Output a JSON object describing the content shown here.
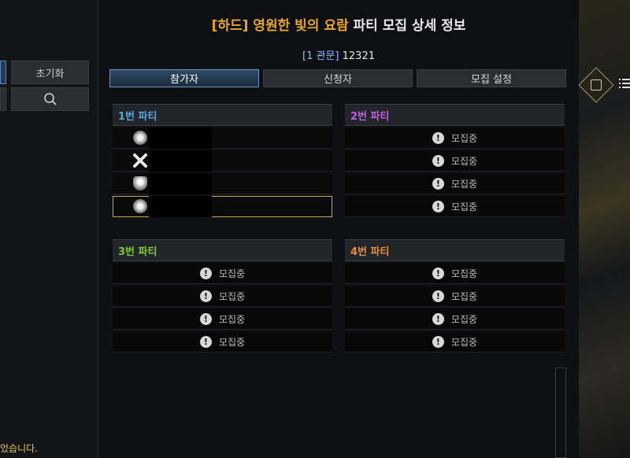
{
  "left": {
    "reset_label": "초기화",
    "notice_tail": "었습니다."
  },
  "window": {
    "title_accent": "[하드] 영원한 빛의 요람",
    "title_rest": "파티 모집 상세 정보",
    "subtitle_bracket": "[1 관문]",
    "subtitle_value": "12321"
  },
  "tabs": [
    {
      "label": "참가자",
      "active": true
    },
    {
      "label": "신청자",
      "active": false
    },
    {
      "label": "모집 설정",
      "active": false
    }
  ],
  "recruit_label": "모집중",
  "parties": [
    {
      "title": "1번 파티",
      "color": "#5aa7e0"
    },
    {
      "title": "2번 파티",
      "color": "#c35ce6"
    },
    {
      "title": "3번 파티",
      "color": "#7fc83c"
    },
    {
      "title": "4번 파티",
      "color": "#e98a3c"
    }
  ],
  "party1_members": [
    {
      "icon": "round-class-icon"
    },
    {
      "icon": "crossed-blades-icon"
    },
    {
      "icon": "crest-icon"
    },
    {
      "icon": "round-class-icon",
      "selected": true
    }
  ]
}
